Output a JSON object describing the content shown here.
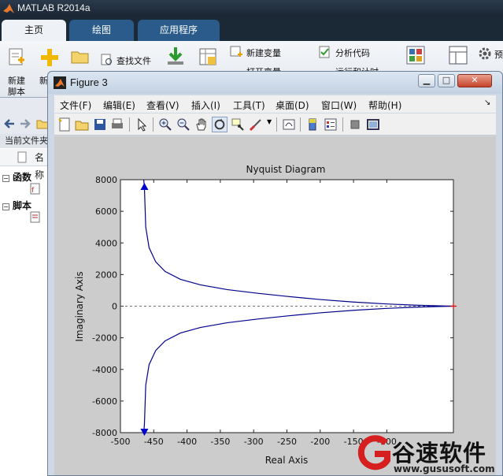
{
  "app": {
    "title": "MATLAB R2014a",
    "tabs": [
      "主页",
      "绘图",
      "应用程序"
    ]
  },
  "ribbon": {
    "new_script": [
      "新建",
      "脚本"
    ],
    "new_partial": "新",
    "find_files": "查找文件",
    "new_variable": "新建变量",
    "open_variable": "打开变量",
    "analyze_code": "分析代码",
    "run_and_time": "运行和计时",
    "prefs_partial": "预"
  },
  "current_folder": {
    "header": "当前文件夹",
    "name_col": "名称",
    "groups": [
      {
        "label": "函数"
      },
      {
        "label": "脚本"
      }
    ]
  },
  "figure": {
    "title": "Figure 3",
    "menus": [
      "文件(F)",
      "编辑(E)",
      "查看(V)",
      "插入(I)",
      "工具(T)",
      "桌面(D)",
      "窗口(W)",
      "帮助(H)"
    ]
  },
  "chart_data": {
    "type": "line",
    "title": "Nyquist Diagram",
    "xlabel": "Real Axis",
    "ylabel": "Imaginary Axis",
    "xlim": [
      -500,
      0
    ],
    "ylim": [
      -8000,
      8000
    ],
    "xticks": [
      -500,
      -450,
      -400,
      -350,
      -300,
      -250,
      -200,
      -150,
      -100
    ],
    "yticks": [
      8000,
      6000,
      4000,
      2000,
      0,
      -2000,
      -4000,
      -6000,
      -8000
    ],
    "series": [
      {
        "points": [
          [
            -464,
            7500
          ],
          [
            -462,
            5000
          ],
          [
            -457,
            3700
          ],
          [
            -447,
            2800
          ],
          [
            -433,
            2200
          ],
          [
            -410,
            1700
          ],
          [
            -380,
            1350
          ],
          [
            -340,
            1050
          ],
          [
            -295,
            820
          ],
          [
            -250,
            620
          ],
          [
            -200,
            420
          ],
          [
            -150,
            260
          ],
          [
            -100,
            140
          ],
          [
            -60,
            70
          ],
          [
            -20,
            20
          ],
          [
            0,
            0
          ]
        ],
        "mirror": true,
        "color": "#00008b"
      }
    ],
    "arrows": [
      [
        -464,
        7500,
        "up"
      ],
      [
        -464,
        -7900,
        "down"
      ]
    ],
    "zero_line": "dashed",
    "origin_marker": "+"
  },
  "watermark": {
    "text": "谷速软件",
    "url": "www.gususoft.com"
  },
  "colors": {
    "ribbon_active_tab": "#eef1f5",
    "ribbon_tab": "#2a5b8b",
    "curve": "#00008b",
    "plot_bg": "#ffffff",
    "figure_bg": "#cccccc"
  }
}
